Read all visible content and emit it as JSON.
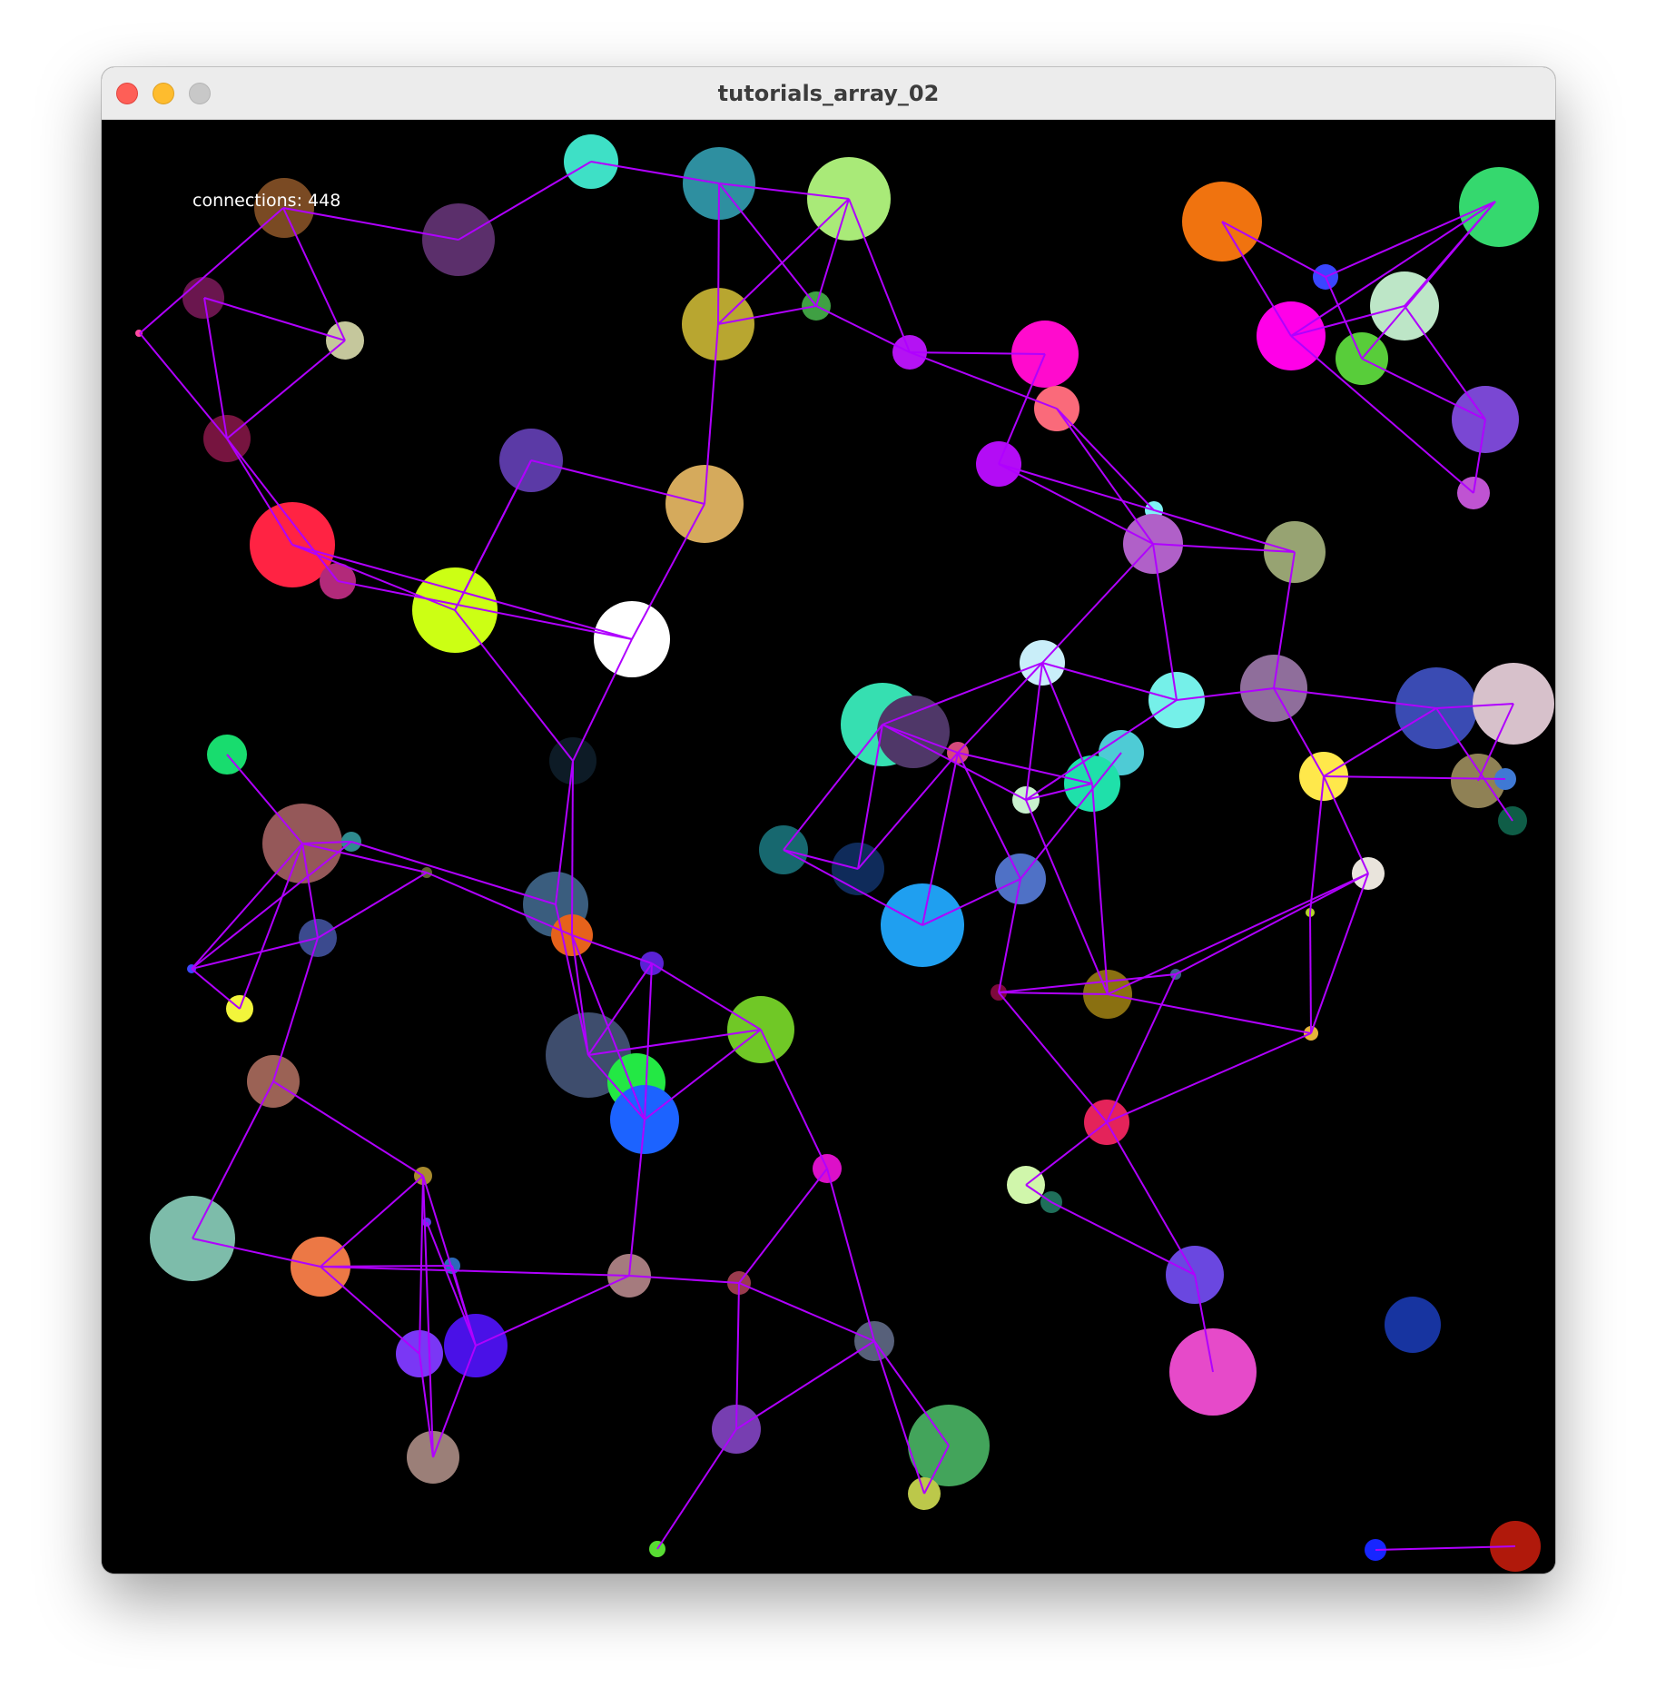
{
  "window": {
    "title": "tutorials_array_02",
    "controls": {
      "close": "close-icon",
      "minimize": "minimize-icon",
      "zoom": "zoom-icon"
    }
  },
  "sketch": {
    "label": "connections:",
    "connections": 448,
    "line_color": "#b000ff",
    "background": "#000000"
  }
}
